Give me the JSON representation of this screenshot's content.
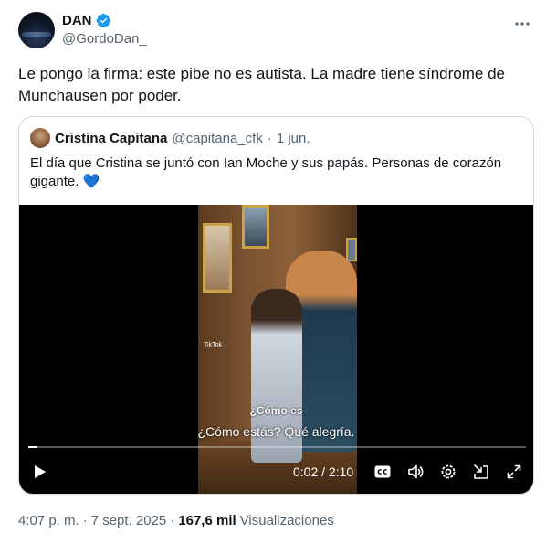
{
  "tweet": {
    "author_name": "DAN",
    "author_handle": "@GordoDan_",
    "text": "Le pongo la firma: este pibe no es autista. La madre tiene síndrome de Munchausen por poder.",
    "time": "4:07 p. m.",
    "separator": "·",
    "date": "7 sept. 2025",
    "views_count": "167,6 mil",
    "views_label": "Visualizaciones"
  },
  "quote": {
    "author_name": "Cristina Capitana",
    "author_handle": "@capitana_cfk",
    "separator": "·",
    "date": "1 jun.",
    "text": "El día que Cristina se juntó con Ian Moche y sus papás. Personas de corazón gigante. 💙"
  },
  "video": {
    "watermark": "TikTok",
    "caption_small": "¿Cómo es",
    "caption": "¿Cómo estás? Qué alegría.",
    "time_display": "0:02 / 2:10",
    "progress": 0.016
  },
  "colors": {
    "verified": "#1d9bf0",
    "secondary_text": "#536471",
    "border": "#cfd9de"
  },
  "icons": [
    "verified-icon",
    "more-icon",
    "play-icon",
    "captions-icon",
    "volume-icon",
    "settings-icon",
    "pip-icon",
    "fullscreen-icon"
  ]
}
